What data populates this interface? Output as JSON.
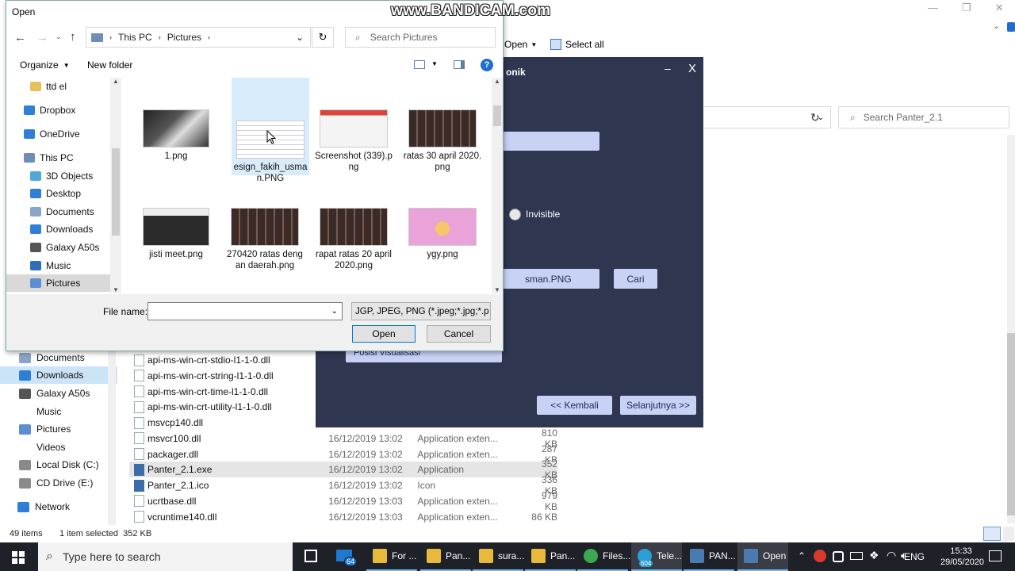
{
  "watermark": "www.BANDICAM.com",
  "background_explorer": {
    "toolbar": {
      "open_label": "Open",
      "select_all_label": "Select all"
    },
    "search_placeholder": "Search Panter_2.1",
    "sidebar": [
      {
        "label": "Documents",
        "icon": "documents-icon"
      },
      {
        "label": "Downloads",
        "icon": "downloads-icon"
      },
      {
        "label": "Galaxy A50s",
        "icon": "phone-icon"
      },
      {
        "label": "Music",
        "icon": "music-icon"
      },
      {
        "label": "Pictures",
        "icon": "pictures-icon"
      },
      {
        "label": "Videos",
        "icon": "videos-icon"
      },
      {
        "label": "Local Disk (C:)",
        "icon": "disk-icon"
      },
      {
        "label": "CD Drive (E:)",
        "icon": "cd-icon"
      },
      {
        "label": "Network",
        "icon": "network-icon"
      }
    ],
    "files": [
      {
        "name": "api-ms-win-crt-stdio-l1-1-0.dll",
        "date": "",
        "type": "",
        "size": ""
      },
      {
        "name": "api-ms-win-crt-string-l1-1-0.dll",
        "date": "",
        "type": "",
        "size": ""
      },
      {
        "name": "api-ms-win-crt-time-l1-1-0.dll",
        "date": "",
        "type": "",
        "size": ""
      },
      {
        "name": "api-ms-win-crt-utility-l1-1-0.dll",
        "date": "",
        "type": "",
        "size": ""
      },
      {
        "name": "msvcp140.dll",
        "date": "",
        "type": "",
        "size": ""
      },
      {
        "name": "msvcr100.dll",
        "date": "16/12/2019 13:02",
        "type": "Application exten...",
        "size": "810 KB"
      },
      {
        "name": "packager.dll",
        "date": "16/12/2019 13:02",
        "type": "Application exten...",
        "size": "287 KB"
      },
      {
        "name": "Panter_2.1.exe",
        "date": "16/12/2019 13:02",
        "type": "Application",
        "size": "352 KB"
      },
      {
        "name": "Panter_2.1.ico",
        "date": "16/12/2019 13:02",
        "type": "Icon",
        "size": "336 KB"
      },
      {
        "name": "ucrtbase.dll",
        "date": "16/12/2019 13:03",
        "type": "Application exten...",
        "size": "979 KB"
      },
      {
        "name": "vcruntime140.dll",
        "date": "16/12/2019 13:03",
        "type": "Application exten...",
        "size": "86 KB"
      }
    ],
    "status": {
      "items": "49 items",
      "selected": "1 item selected  352 KB"
    }
  },
  "panter_dialog": {
    "title_fragment": "onik",
    "minimize": "–",
    "close": "X",
    "invisible_label": "Invisible",
    "file_field_value": "sman.PNG",
    "cari_label": "Cari",
    "posisi_label": "Posisi Visualisasi",
    "back_label": "<< Kembali",
    "next_label": "Selanjutnya >>"
  },
  "open_dialog": {
    "title": "Open",
    "breadcrumb": [
      "This PC",
      "Pictures"
    ],
    "search_placeholder": "Search Pictures",
    "organize_label": "Organize",
    "new_folder_label": "New folder",
    "nav": [
      {
        "label": "ttd el",
        "icon": "folder-icon"
      },
      {
        "label": "Dropbox",
        "icon": "dropbox-icon"
      },
      {
        "label": "OneDrive",
        "icon": "onedrive-icon"
      },
      {
        "label": "This PC",
        "icon": "pc-icon"
      },
      {
        "label": "3D Objects",
        "icon": "3d-objects-icon"
      },
      {
        "label": "Desktop",
        "icon": "desktop-icon"
      },
      {
        "label": "Documents",
        "icon": "documents-icon"
      },
      {
        "label": "Downloads",
        "icon": "downloads-icon"
      },
      {
        "label": "Galaxy A50s",
        "icon": "phone-icon"
      },
      {
        "label": "Music",
        "icon": "music-icon"
      },
      {
        "label": "Pictures",
        "icon": "pictures-icon"
      }
    ],
    "thumbnails": [
      {
        "caption": "1.png",
        "style": "dark"
      },
      {
        "caption": "esign_fakih_usman.PNG",
        "style": "doc"
      },
      {
        "caption": "Screenshot (339).png",
        "style": "red"
      },
      {
        "caption": "ratas 30 april 2020.png",
        "style": "grid"
      },
      {
        "caption": "jisti meet.png",
        "style": "meet"
      },
      {
        "caption": "270420 ratas dengan daerah.png",
        "style": "grid"
      },
      {
        "caption": "rapat ratas 20 april 2020.png",
        "style": "grid"
      },
      {
        "caption": "ygy.png",
        "style": "pink"
      }
    ],
    "file_name_label": "File name:",
    "file_name_value": "",
    "filter_value": "JGP, JPEG, PNG (*.jpeg;*.jpg;*.p",
    "open_label": "Open",
    "cancel_label": "Cancel"
  },
  "taskbar": {
    "search_placeholder": "Type here to search",
    "mail_badge": "64",
    "telegram_badge": "604",
    "apps": [
      {
        "label": "For ...",
        "icon": "folder-icon"
      },
      {
        "label": "Pan...",
        "icon": "folder-icon"
      },
      {
        "label": "sura...",
        "icon": "folder-icon"
      },
      {
        "label": "Pan...",
        "icon": "folder-icon"
      },
      {
        "label": "Files...",
        "icon": "chrome-icon"
      },
      {
        "label": "Tele...",
        "icon": "telegram-icon"
      },
      {
        "label": "PAN...",
        "icon": "panter-icon"
      },
      {
        "label": "Open",
        "icon": "panter-icon"
      }
    ],
    "language": "ENG",
    "time": "15:33",
    "date": "29/05/2020"
  }
}
